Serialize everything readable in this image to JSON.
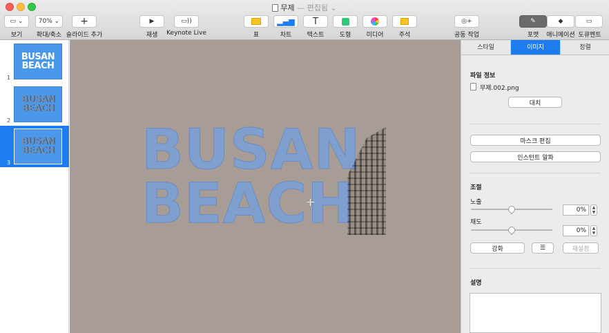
{
  "window": {
    "title": "무제",
    "subtitle": "— 편집됨 ⌄"
  },
  "toolbar": {
    "view_label": "보기",
    "zoom_value": "70% ⌄",
    "zoom_label": "확대/축소",
    "add_slide_label": "슬라이드 추가",
    "play_label": "재생",
    "keynote_live_label": "Keynote Live",
    "table_label": "표",
    "chart_label": "차트",
    "text_label": "텍스트",
    "shape_label": "도형",
    "media_label": "미디어",
    "comment_label": "주석",
    "collaborate_label": "공동 작업",
    "format_label": "포맷",
    "animate_label": "애니메이션",
    "document_label": "도큐멘트"
  },
  "slides": [
    {
      "number": "1",
      "line1": "BUSAN",
      "line2": "BEACH"
    },
    {
      "number": "2",
      "line1": "BUSAN",
      "line2": "BEACH"
    },
    {
      "number": "3",
      "line1": "BUSAN",
      "line2": "BEACH"
    }
  ],
  "canvas": {
    "line1": "BUSAN",
    "line2": "BEACH"
  },
  "inspector": {
    "tabs": [
      "스타일",
      "이미지",
      "정렬"
    ],
    "file_info_heading": "파일 정보",
    "file_name": "무제.002.png",
    "replace_button": "대치",
    "edit_mask_button": "마스크 편집",
    "instant_alpha_button": "인스턴트 알파",
    "adjust_heading": "조절",
    "exposure_label": "노출",
    "exposure_value": "0%",
    "saturation_label": "채도",
    "saturation_value": "0%",
    "enhance_button": "강화",
    "reset_button": "재설정",
    "description_heading": "설명"
  },
  "colors": {
    "accent": "#1c7cf0",
    "canvas_bg": "#a79d96",
    "text_fill": "#7fa0cf"
  }
}
